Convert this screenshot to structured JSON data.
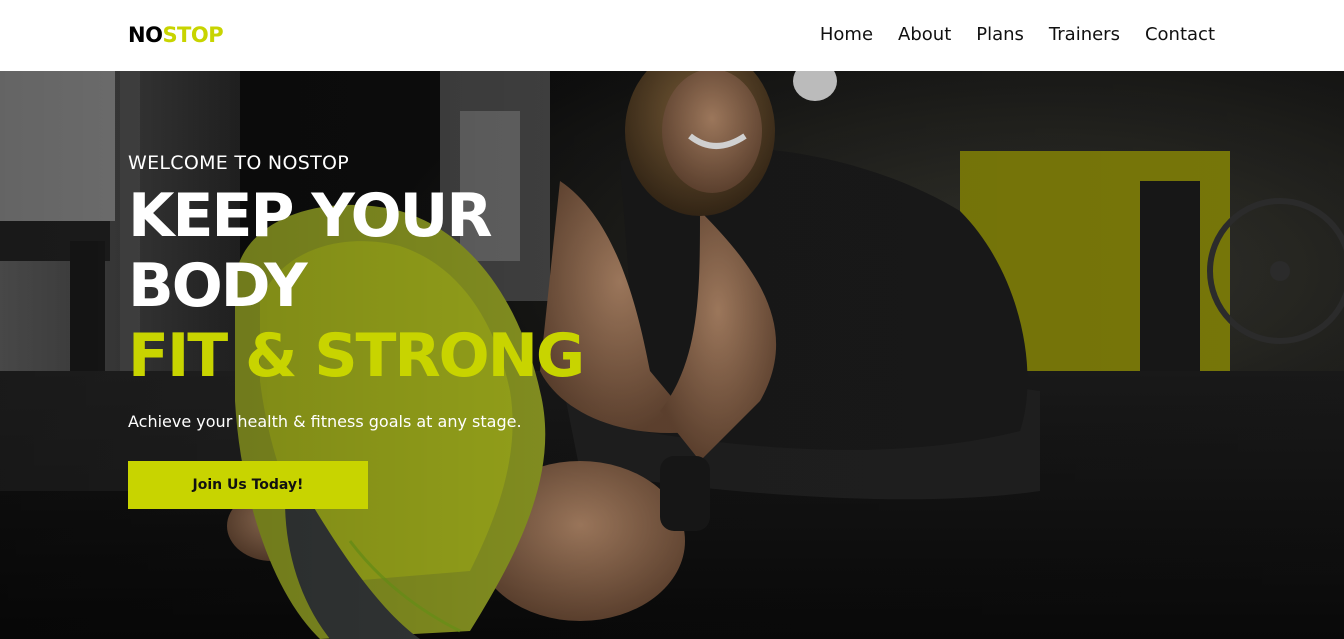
{
  "nav": {
    "logo_primary": "NO",
    "logo_accent": "STOP",
    "links": [
      "Home",
      "About",
      "Plans",
      "Trainers",
      "Contact"
    ]
  },
  "hero": {
    "eyebrow": "WELCOME TO NOSTOP",
    "headline_line1": "KEEP YOUR",
    "headline_line2": "BODY",
    "headline_line3": "FIT & STRONG",
    "subtitle": "Achieve your health & fitness goals at any stage.",
    "cta_label": "Join Us Today!"
  },
  "colors": {
    "accent": "#c8d400",
    "nav_background": "#ffffff",
    "text_dark": "#111111",
    "text_light": "#ffffff"
  }
}
